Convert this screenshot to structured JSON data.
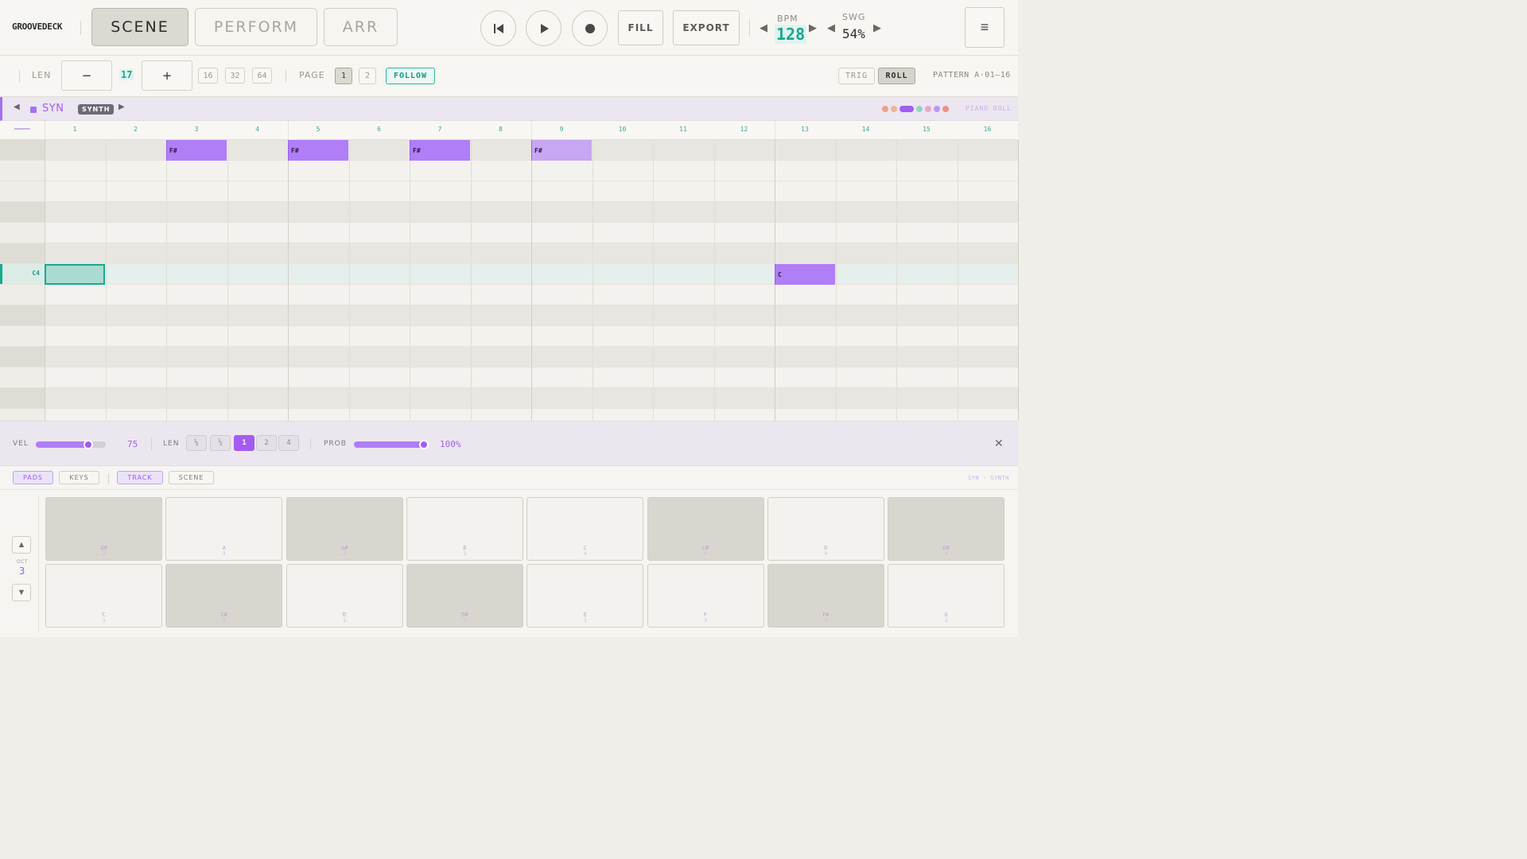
{
  "header": {
    "brand": "GROOVEDECK",
    "modes": [
      "SCENE",
      "PERFORM",
      "ARR"
    ],
    "active_mode": "SCENE",
    "fill_label": "FILL",
    "export_label": "EXPORT",
    "bpm_label": "BPM",
    "bpm_value": "128",
    "swing_label": "SWG",
    "swing_value": "54%",
    "menu_icon": "≡"
  },
  "toolbar": {
    "len_label": "LEN",
    "minus": "−",
    "len_value": "17",
    "plus": "+",
    "len_presets": [
      "16",
      "32",
      "64"
    ],
    "page_label": "PAGE",
    "pages": [
      "1",
      "2"
    ],
    "active_page": "1",
    "follow_label": "FOLLOW",
    "trig_label": "TRIG",
    "roll_label": "ROLL",
    "pattern_label": "PATTERN A·01–16"
  },
  "track": {
    "name": "SYN",
    "type_badge": "SYNTH",
    "prev_icon": "◀",
    "next_icon": "▶",
    "view_label": "PIANO ROLL",
    "track_colors": [
      "#eea08d",
      "#eeb58d",
      "#a35cf0",
      "#8fd6c5",
      "#e9a6c9",
      "#b79af0",
      "#ef8f86"
    ]
  },
  "ruler": {
    "steps": [
      "1",
      "2",
      "3",
      "4",
      "5",
      "6",
      "7",
      "8",
      "9",
      "10",
      "11",
      "12",
      "13",
      "14",
      "15",
      "16"
    ]
  },
  "piano_roll": {
    "selected_row_label": "C4",
    "notes": [
      {
        "row": 0,
        "step": 3,
        "label": "F#",
        "ghost": false
      },
      {
        "row": 0,
        "step": 5,
        "label": "F#",
        "ghost": false
      },
      {
        "row": 0,
        "step": 7,
        "label": "F#",
        "ghost": false
      },
      {
        "row": 0,
        "step": 9,
        "label": "F#",
        "ghost": true
      },
      {
        "row": 6,
        "step": 13,
        "label": "C",
        "ghost": false
      }
    ]
  },
  "editor": {
    "vel_label": "VEL",
    "vel_value": "75",
    "vel_fraction": 0.75,
    "len_label": "LEN",
    "len_options": [
      "¼",
      "½",
      "1",
      "2",
      "4"
    ],
    "len_active": "1",
    "prob_label": "PROB",
    "prob_value": "100%",
    "prob_fraction": 1.0,
    "close_icon": "✕"
  },
  "tabs": {
    "pads": "PADS",
    "keys": "KEYS",
    "track": "TRACK",
    "scene": "SCENE",
    "track_info": "SYN · SYNTH"
  },
  "pads": {
    "octave_label": "OCT",
    "octave_value": "3",
    "up_icon": "▲",
    "down_icon": "▼",
    "top_row": [
      {
        "note": "G#",
        "oct": "3",
        "black": true
      },
      {
        "note": "A",
        "oct": "3",
        "black": false
      },
      {
        "note": "A#",
        "oct": "3",
        "black": true
      },
      {
        "note": "B",
        "oct": "3",
        "black": false
      },
      {
        "note": "C",
        "oct": "4",
        "black": false
      },
      {
        "note": "C#",
        "oct": "4",
        "black": true
      },
      {
        "note": "D",
        "oct": "4",
        "black": false
      },
      {
        "note": "D#",
        "oct": "4",
        "black": true
      }
    ],
    "bottom_row": [
      {
        "note": "C",
        "oct": "3",
        "black": false
      },
      {
        "note": "C#",
        "oct": "3",
        "black": true
      },
      {
        "note": "D",
        "oct": "3",
        "black": false
      },
      {
        "note": "D#",
        "oct": "3",
        "black": true
      },
      {
        "note": "E",
        "oct": "3",
        "black": false
      },
      {
        "note": "F",
        "oct": "3",
        "black": false
      },
      {
        "note": "F#",
        "oct": "3",
        "black": true
      },
      {
        "note": "G",
        "oct": "3",
        "black": false
      }
    ]
  }
}
